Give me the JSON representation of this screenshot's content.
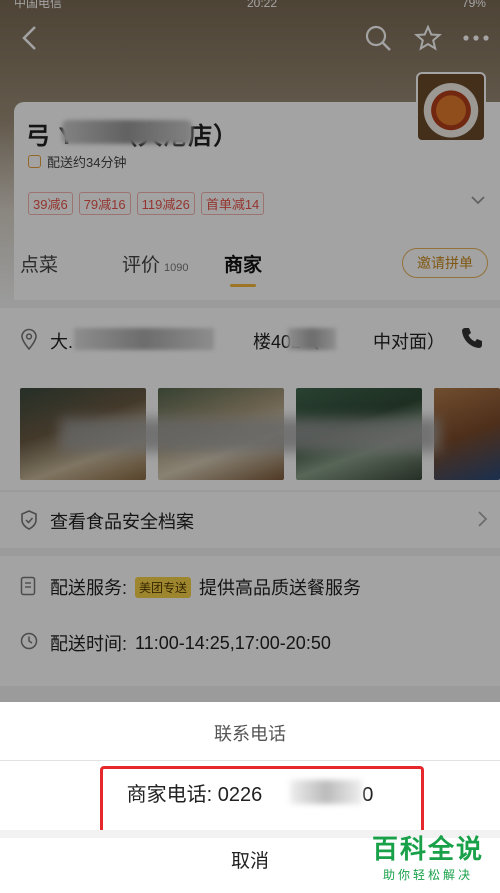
{
  "status_bar": {
    "carrier": "中国电信",
    "time": "20:22",
    "battery": "79%"
  },
  "shop": {
    "name": "弓 Y　　（大港店）",
    "delivery_time": "配送约34分钟",
    "promos": [
      "39减6",
      "79减16",
      "119减26",
      "首单减14"
    ]
  },
  "tabs": {
    "order": "点菜",
    "review": "评价",
    "review_count": "1090",
    "merchant": "商家"
  },
  "invite_button": "邀请拼单",
  "address": {
    "text": "大.　　　　　　　　　　楼402（　　　中对面）"
  },
  "safety_row": "查看食品安全档案",
  "delivery_service": {
    "label": "配送服务:",
    "tag": "美团专送",
    "value": "提供高品质送餐服务"
  },
  "delivery_hours": {
    "label": "配送时间:",
    "value": "11:00-14:25,17:00-20:50"
  },
  "sheet": {
    "title": "联系电话",
    "phone_label": "商家电话: 0226　　　　　0",
    "cancel": "取消"
  },
  "watermark": {
    "main": "百科全说",
    "sub": "助你轻松解决"
  },
  "colors": {
    "accent": "#f4b73a",
    "promo_red": "#e8544b",
    "highlight": "#e6282c",
    "watermark_green": "#19a14a"
  },
  "icons": [
    "back-icon",
    "search-icon",
    "star-icon",
    "more-icon",
    "clock-icon",
    "chevron-down-icon",
    "location-pin-icon",
    "phone-icon",
    "shield-icon",
    "chevron-right-icon",
    "document-icon"
  ]
}
